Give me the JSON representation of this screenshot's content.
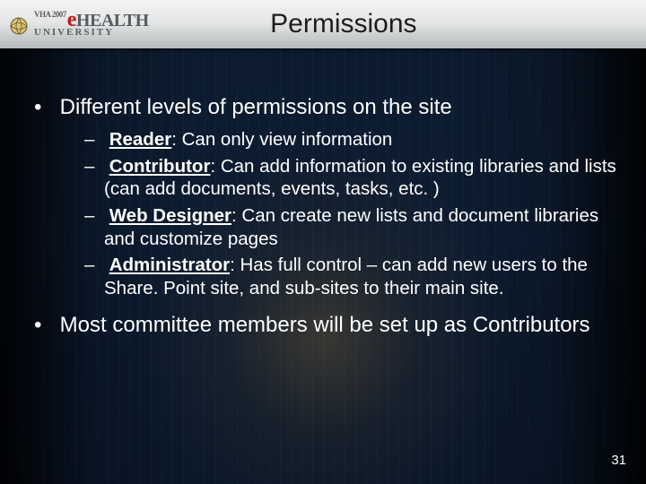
{
  "header": {
    "logo_tag": "VHA 2007",
    "logo_big_e": "e",
    "logo_rest": "HEALTH",
    "logo_sub": "UNIVERSITY",
    "title": "Permissions"
  },
  "bullets": {
    "b1": "Different levels of permissions on the site",
    "sub": {
      "s1_label": "Reader",
      "s1_text": ": Can only view information",
      "s2_label": "Contributor",
      "s2_text": ": Can add information to existing libraries and lists (can add documents, events, tasks, etc. )",
      "s3_label": "Web Designer",
      "s3_text": ": Can create new lists and document libraries and customize pages",
      "s4_label": "Administrator",
      "s4_text": ": Has full control – can add new users to the Share. Point site, and sub-sites to their main site."
    },
    "b2": "Most committee members will be set up as Contributors"
  },
  "page_number": "31"
}
